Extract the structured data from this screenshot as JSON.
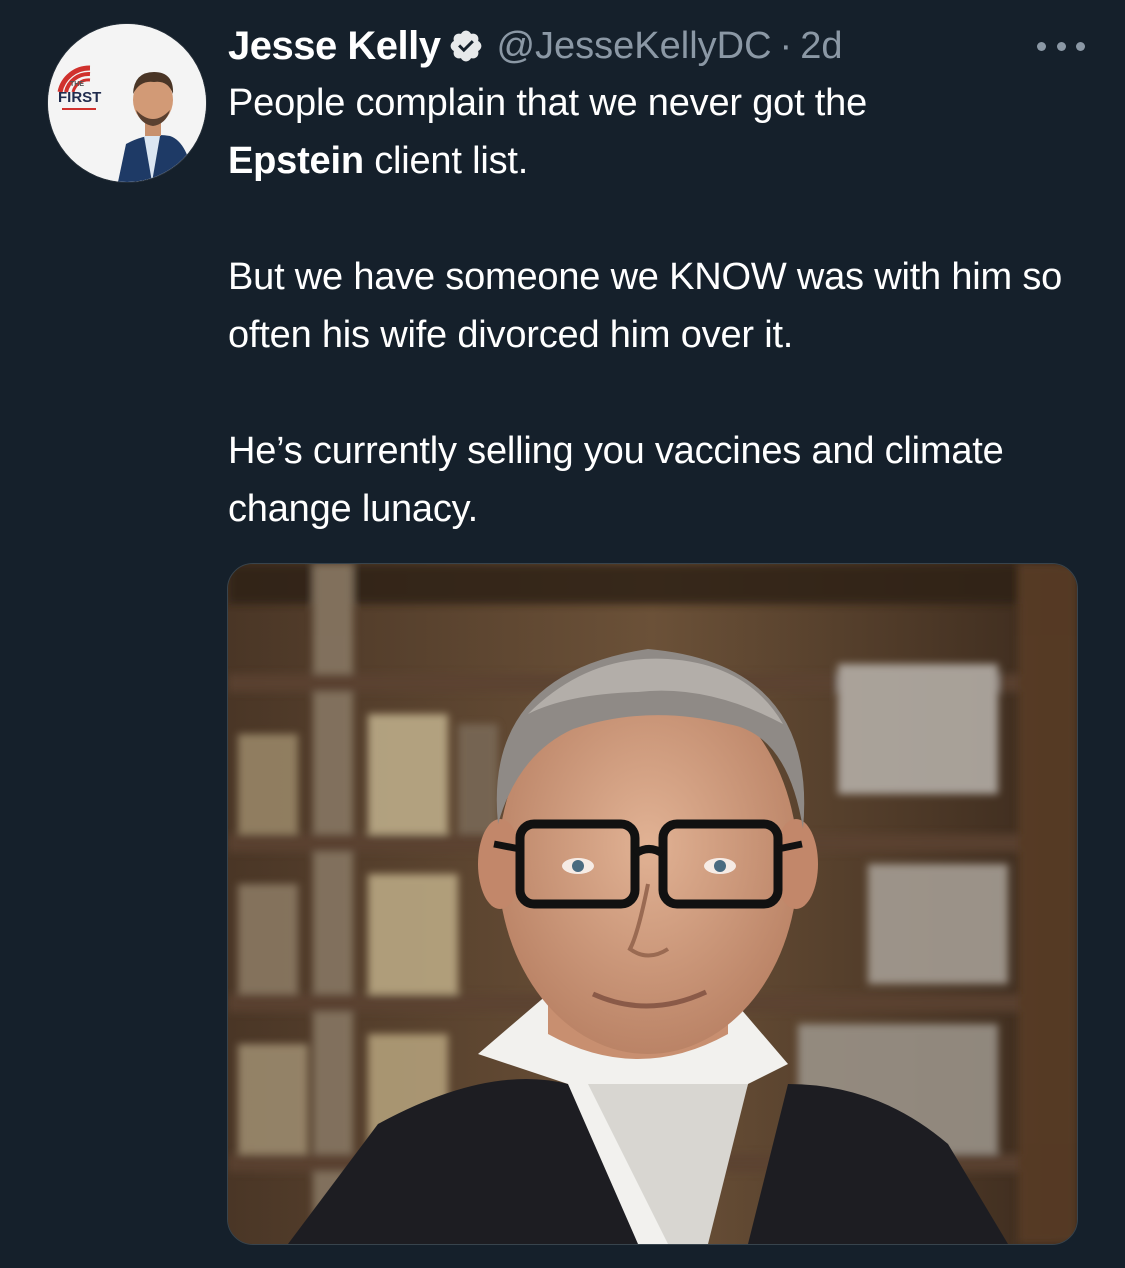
{
  "tweet": {
    "author": {
      "display_name": "Jesse Kelly",
      "handle": "@JesseKellyDC",
      "verified_icon": "verified-badge-icon",
      "avatar_badge": {
        "small": "THE",
        "main": "FIRST"
      }
    },
    "separator": "·",
    "timestamp": "2d",
    "more_icon": "more-options-icon",
    "text": {
      "p1_part1": "People complain that we never got the",
      "p1_bold": "Epstein",
      "p1_part2": " client list.",
      "p2": "But we have someone we KNOW was with him so often his wife divorced him over it.",
      "p3": "He’s currently selling you vaccines and climate change lunacy."
    },
    "media": {
      "kind": "photo"
    }
  },
  "colors": {
    "background": "#15202b",
    "primary_text": "#ffffff",
    "secondary_text": "#8b98a5",
    "media_border": "#38444d",
    "badge_red": "#d0312d"
  }
}
